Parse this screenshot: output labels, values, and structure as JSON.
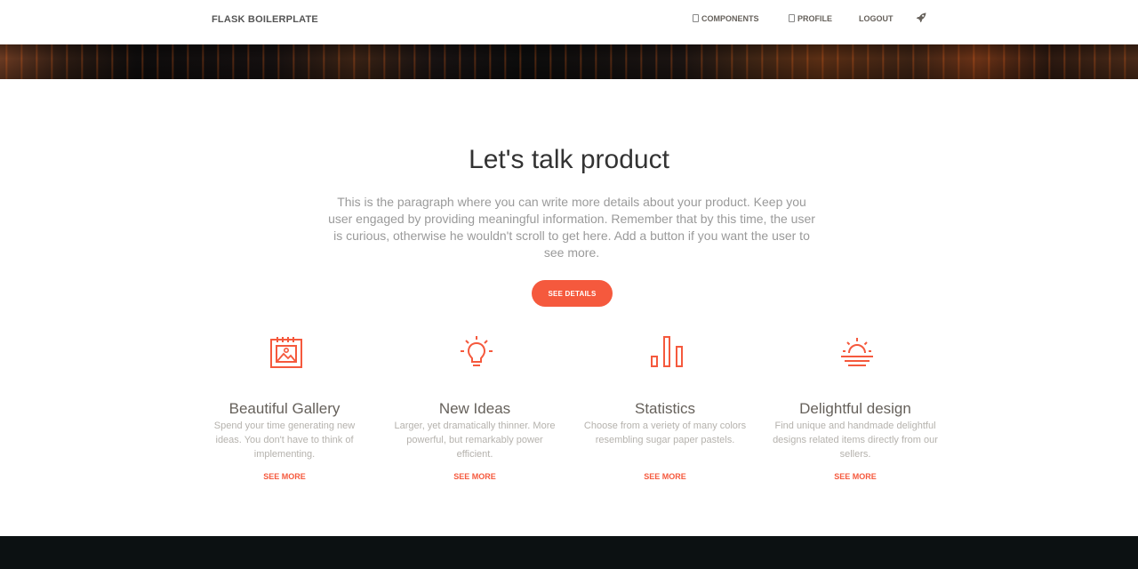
{
  "navbar": {
    "brand": "FLASK BOILERPLATE",
    "items": [
      {
        "label": "COMPONENTS",
        "icon": "layout-icon"
      },
      {
        "label": "PROFILE",
        "icon": "file-icon"
      },
      {
        "label": "LOGOUT"
      },
      {
        "icon": "rocket-icon"
      }
    ]
  },
  "main": {
    "title": "Let's talk product",
    "description": "This is the paragraph where you can write more details about your product. Keep you user engaged by providing meaningful information. Remember that by this time, the user is curious, otherwise he wouldn't scroll to get here. Add a button if you want the user to see more.",
    "button_label": "SEE DETAILS"
  },
  "features": [
    {
      "icon": "gallery-icon",
      "title": "Beautiful Gallery",
      "description": "Spend your time generating new ideas. You don't have to think of implementing.",
      "link": "SEE MORE"
    },
    {
      "icon": "bulb-icon",
      "title": "New Ideas",
      "description": "Larger, yet dramatically thinner. More powerful, but remarkably power efficient.",
      "link": "SEE MORE"
    },
    {
      "icon": "chart-bar-icon",
      "title": "Statistics",
      "description": "Choose from a veriety of many colors resembling sugar paper pastels.",
      "link": "SEE MORE"
    },
    {
      "icon": "sunrise-icon",
      "title": "Delightful design",
      "description": "Find unique and handmade delightful designs related items directly from our sellers.",
      "link": "SEE MORE"
    }
  ],
  "colors": {
    "accent": "#f5593d",
    "footer": "#0c1112",
    "text_muted": "#9a9a9a"
  }
}
